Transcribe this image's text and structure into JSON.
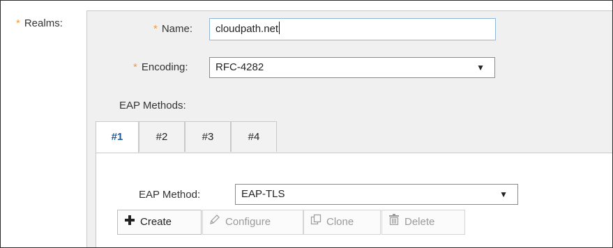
{
  "realms": {
    "label": "Realms:",
    "required_mark": "*"
  },
  "name": {
    "label": "Name:",
    "required_mark": "*",
    "value": "cloudpath.net"
  },
  "encoding": {
    "label": "Encoding:",
    "required_mark": "*",
    "selected": "RFC-4282"
  },
  "eap_methods": {
    "label": "EAP Methods:",
    "tabs": [
      {
        "label": "#1",
        "active": true
      },
      {
        "label": "#2",
        "active": false
      },
      {
        "label": "#3",
        "active": false
      },
      {
        "label": "#4",
        "active": false
      }
    ],
    "method_label": "EAP Method:",
    "method_selected": "EAP-TLS"
  },
  "buttons": {
    "create": "Create",
    "configure": "Configure",
    "clone": "Clone",
    "delete": "Delete"
  },
  "icons": {
    "plus": "plus-icon",
    "pencil": "pencil-icon",
    "clone": "clone-icon",
    "trash": "trash-icon",
    "dropdown": "caret-down-icon"
  },
  "colors": {
    "required": "#f09a3e",
    "active_tab_text": "#1f5c99",
    "input_border": "#8fb6d9",
    "panel_bg": "#f0f0f0"
  }
}
